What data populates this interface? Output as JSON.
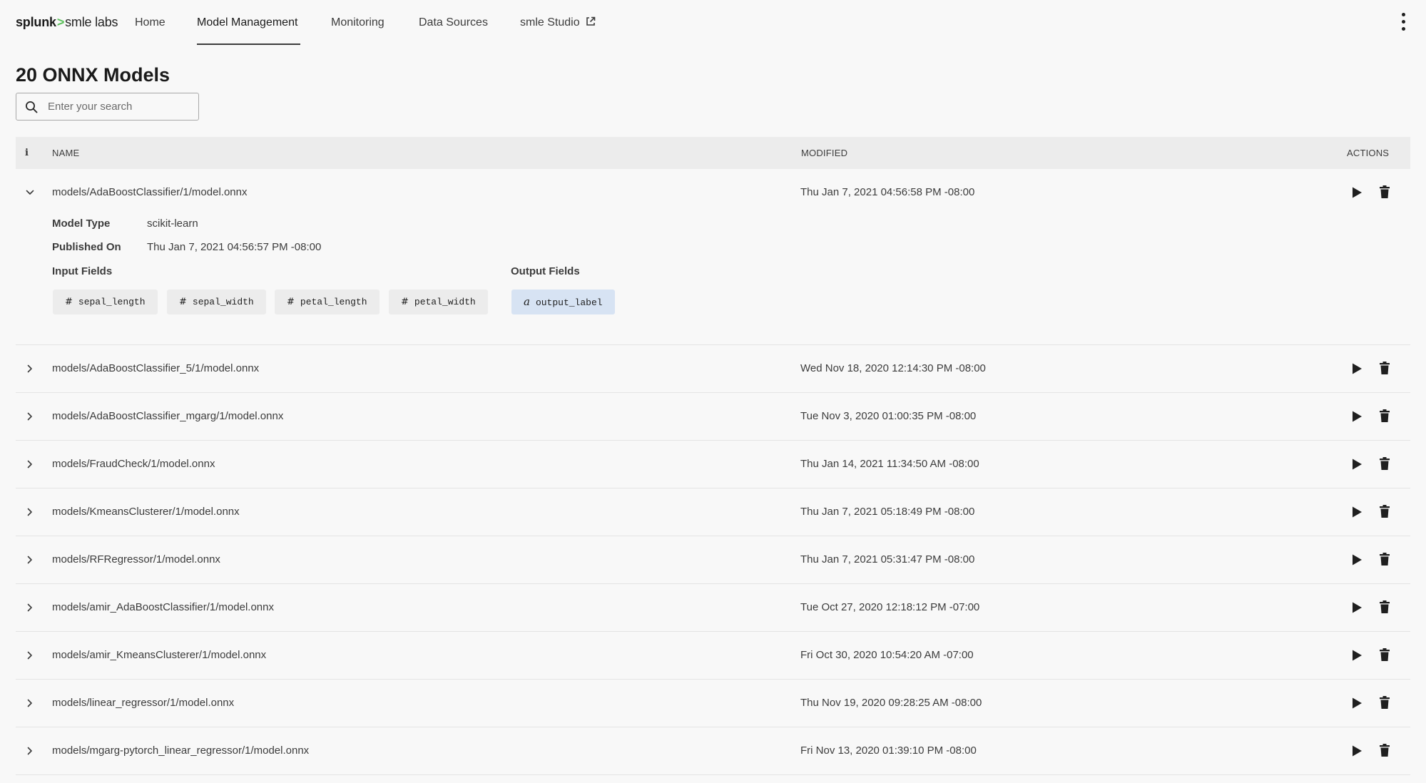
{
  "brand": {
    "name": "splunk",
    "separator": ">",
    "product": "smle labs"
  },
  "nav": {
    "tabs": [
      {
        "label": "Home"
      },
      {
        "label": "Model Management"
      },
      {
        "label": "Monitoring"
      },
      {
        "label": "Data Sources"
      },
      {
        "label": "smle Studio"
      }
    ],
    "active_tab": "Model Management"
  },
  "page": {
    "title": "20 ONNX Models",
    "search": {
      "placeholder": "Enter your search",
      "value": ""
    }
  },
  "table": {
    "headers": {
      "info": "i",
      "name": "NAME",
      "modified": "MODIFIED",
      "actions": "ACTIONS"
    },
    "rows": [
      {
        "name": "models/AdaBoostClassifier/1/model.onnx",
        "modified": "Thu Jan 7, 2021 04:56:58 PM -08:00",
        "expanded": true
      },
      {
        "name": "models/AdaBoostClassifier_5/1/model.onnx",
        "modified": "Wed Nov 18, 2020 12:14:30 PM -08:00"
      },
      {
        "name": "models/AdaBoostClassifier_mgarg/1/model.onnx",
        "modified": "Tue Nov 3, 2020 01:00:35 PM -08:00"
      },
      {
        "name": "models/FraudCheck/1/model.onnx",
        "modified": "Thu Jan 14, 2021 11:34:50 AM -08:00"
      },
      {
        "name": "models/KmeansClusterer/1/model.onnx",
        "modified": "Thu Jan 7, 2021 05:18:49 PM -08:00"
      },
      {
        "name": "models/RFRegressor/1/model.onnx",
        "modified": "Thu Jan 7, 2021 05:31:47 PM -08:00"
      },
      {
        "name": "models/amir_AdaBoostClassifier/1/model.onnx",
        "modified": "Tue Oct 27, 2020 12:18:12 PM -07:00"
      },
      {
        "name": "models/amir_KmeansClusterer/1/model.onnx",
        "modified": "Fri Oct 30, 2020 10:54:20 AM -07:00"
      },
      {
        "name": "models/linear_regressor/1/model.onnx",
        "modified": "Thu Nov 19, 2020 09:28:25 AM -08:00"
      },
      {
        "name": "models/mgarg-pytorch_linear_regressor/1/model.onnx",
        "modified": "Fri Nov 13, 2020 01:39:10 PM -08:00"
      }
    ]
  },
  "details": {
    "model_type_label": "Model Type",
    "model_type": "scikit-learn",
    "published_on_label": "Published On",
    "published_on": "Thu Jan 7, 2021 04:56:57 PM -08:00",
    "input_fields_label": "Input Fields",
    "output_fields_label": "Output Fields",
    "input_fields": [
      {
        "icon": "#",
        "name": "sepal_length"
      },
      {
        "icon": "#",
        "name": "sepal_width"
      },
      {
        "icon": "#",
        "name": "petal_length"
      },
      {
        "icon": "#",
        "name": "petal_width"
      }
    ],
    "output_fields": [
      {
        "icon": "a",
        "name": "output_label"
      }
    ]
  },
  "icons": {
    "search": "search-icon",
    "menu": "kebab-menu-icon",
    "external": "external-link-icon",
    "expand": "chevron-right-icon",
    "collapse": "chevron-down-icon",
    "run": "play-icon",
    "delete": "trash-icon"
  },
  "colors": {
    "background": "#f8f8f8",
    "header_bg": "#ececec",
    "output_chip_bg": "#d7e3f3",
    "brand_caret": "#5cc05c",
    "text": "#3c3c3c"
  }
}
